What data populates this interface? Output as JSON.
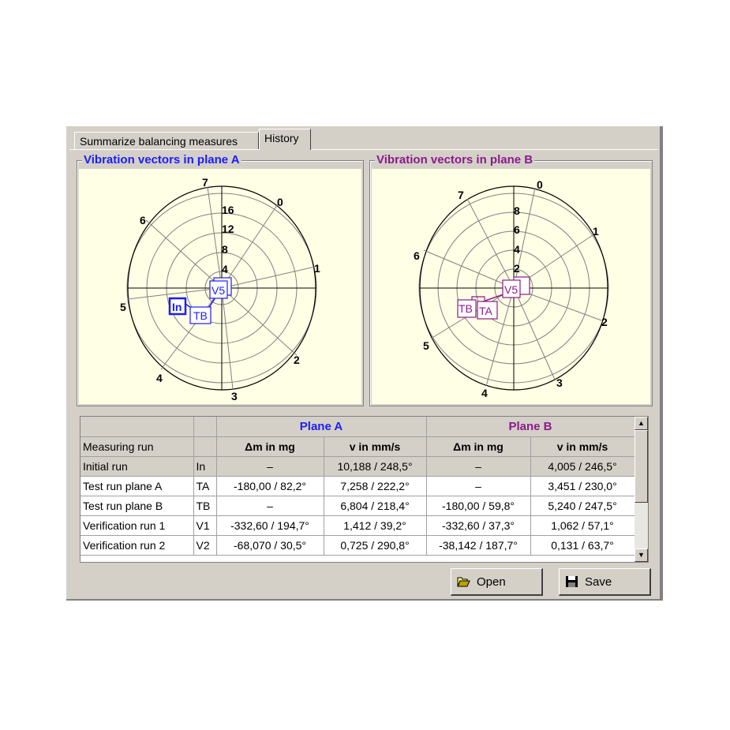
{
  "tabs": [
    {
      "label": "Summarize balancing measures"
    },
    {
      "label": "History",
      "active": true
    }
  ],
  "plots": {
    "plane_a": {
      "title": "Vibration vectors in plane A",
      "color": "#1c1cff",
      "angle_labels": [
        "0",
        "1",
        "2",
        "3",
        "4",
        "5",
        "6",
        "7"
      ],
      "radius_labels": [
        "4",
        "8",
        "12",
        "16"
      ],
      "markers": [
        "V5",
        "In",
        "TB"
      ]
    },
    "plane_b": {
      "title": "Vibration vectors in plane B",
      "color": "#8a1a8a",
      "angle_labels": [
        "0",
        "1",
        "2",
        "3",
        "4",
        "5",
        "6",
        "7"
      ],
      "radius_labels": [
        "2",
        "4",
        "6",
        "8"
      ],
      "markers": [
        "V5",
        "TB",
        "TA"
      ]
    }
  },
  "table": {
    "plane_a_header": "Plane A",
    "plane_b_header": "Plane B",
    "col_run": "Measuring run",
    "col_dm_a": "Δm in mg",
    "col_v_a": "v in mm/s",
    "col_dm_b": "Δm in mg",
    "col_v_b": "v in mm/s",
    "rows": [
      {
        "name": "Initial run",
        "code": "In",
        "dm_a": "–",
        "v_a": "10,188 / 248,5°",
        "dm_b": "–",
        "v_b": "4,005 / 246,5°"
      },
      {
        "name": "Test run plane A",
        "code": "TA",
        "dm_a": "-180,00 / 82,2°",
        "v_a": "7,258 / 222,2°",
        "dm_b": "–",
        "v_b": "3,451 / 230,0°"
      },
      {
        "name": "Test run plane B",
        "code": "TB",
        "dm_a": "–",
        "v_a": "6,804 / 218,4°",
        "dm_b": "-180,00 / 59,8°",
        "v_b": "5,240 / 247,5°"
      },
      {
        "name": "Verification run 1",
        "code": "V1",
        "dm_a": "-332,60 / 194,7°",
        "v_a": "1,412 / 39,2°",
        "dm_b": "-332,60 / 37,3°",
        "v_b": "1,062 / 57,1°"
      },
      {
        "name": "Verification run 2",
        "code": "V2",
        "dm_a": "-68,070 / 30,5°",
        "v_a": "0,725 / 290,8°",
        "dm_b": "-38,142 / 187,7°",
        "v_b": "0,131 / 63,7°"
      }
    ]
  },
  "buttons": {
    "open_label": "Open",
    "open_icon": "folder-open-icon",
    "save_label": "Save",
    "save_icon": "floppy-disk-icon"
  }
}
